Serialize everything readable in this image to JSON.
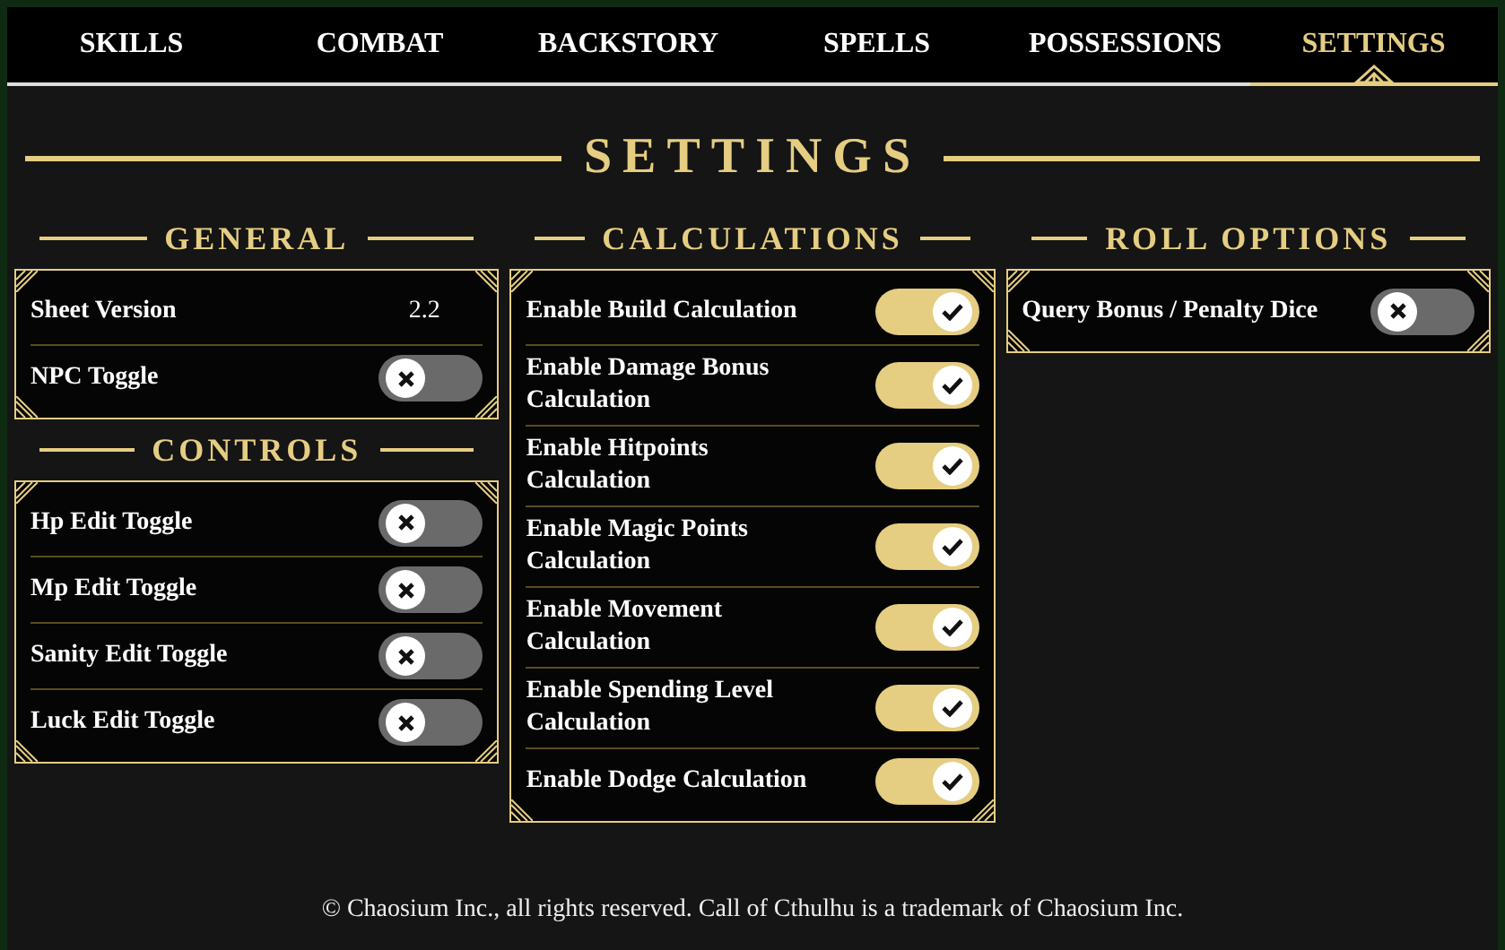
{
  "tabs": [
    {
      "label": "SKILLS",
      "selected": false
    },
    {
      "label": "COMBAT",
      "selected": false
    },
    {
      "label": "BACKSTORY",
      "selected": false
    },
    {
      "label": "SPELLS",
      "selected": false
    },
    {
      "label": "POSSESSIONS",
      "selected": false
    },
    {
      "label": "SETTINGS",
      "selected": true
    }
  ],
  "page_title": "SETTINGS",
  "columns": [
    {
      "sections": [
        {
          "title": "GENERAL",
          "rows": [
            {
              "kind": "value",
              "label": "Sheet Version",
              "value": "2.2"
            },
            {
              "kind": "toggle",
              "label": "NPC Toggle",
              "on": false
            }
          ]
        },
        {
          "title": "CONTROLS",
          "rows": [
            {
              "kind": "toggle",
              "label": "Hp Edit Toggle",
              "on": false
            },
            {
              "kind": "toggle",
              "label": "Mp Edit Toggle",
              "on": false
            },
            {
              "kind": "toggle",
              "label": "Sanity Edit Toggle",
              "on": false
            },
            {
              "kind": "toggle",
              "label": "Luck Edit Toggle",
              "on": false
            }
          ]
        }
      ]
    },
    {
      "sections": [
        {
          "title": "CALCULATIONS",
          "rows": [
            {
              "kind": "toggle",
              "label": "Enable Build Calculation",
              "on": true
            },
            {
              "kind": "toggle",
              "label": "Enable Damage Bonus Calculation",
              "on": true
            },
            {
              "kind": "toggle",
              "label": "Enable Hitpoints Calculation",
              "on": true
            },
            {
              "kind": "toggle",
              "label": "Enable Magic Points Calculation",
              "on": true
            },
            {
              "kind": "toggle",
              "label": "Enable Movement Calculation",
              "on": true
            },
            {
              "kind": "toggle",
              "label": "Enable Spending Level Calculation",
              "on": true
            },
            {
              "kind": "toggle",
              "label": "Enable Dodge Calculation",
              "on": true
            }
          ]
        }
      ]
    },
    {
      "sections": [
        {
          "title": "ROLL OPTIONS",
          "rows": [
            {
              "kind": "toggle",
              "label": "Query Bonus / Penalty Dice",
              "on": false
            }
          ]
        }
      ]
    }
  ],
  "footer": "© Chaosium Inc., all rights reserved. Call of Cthulhu is a trademark of Chaosium Inc."
}
